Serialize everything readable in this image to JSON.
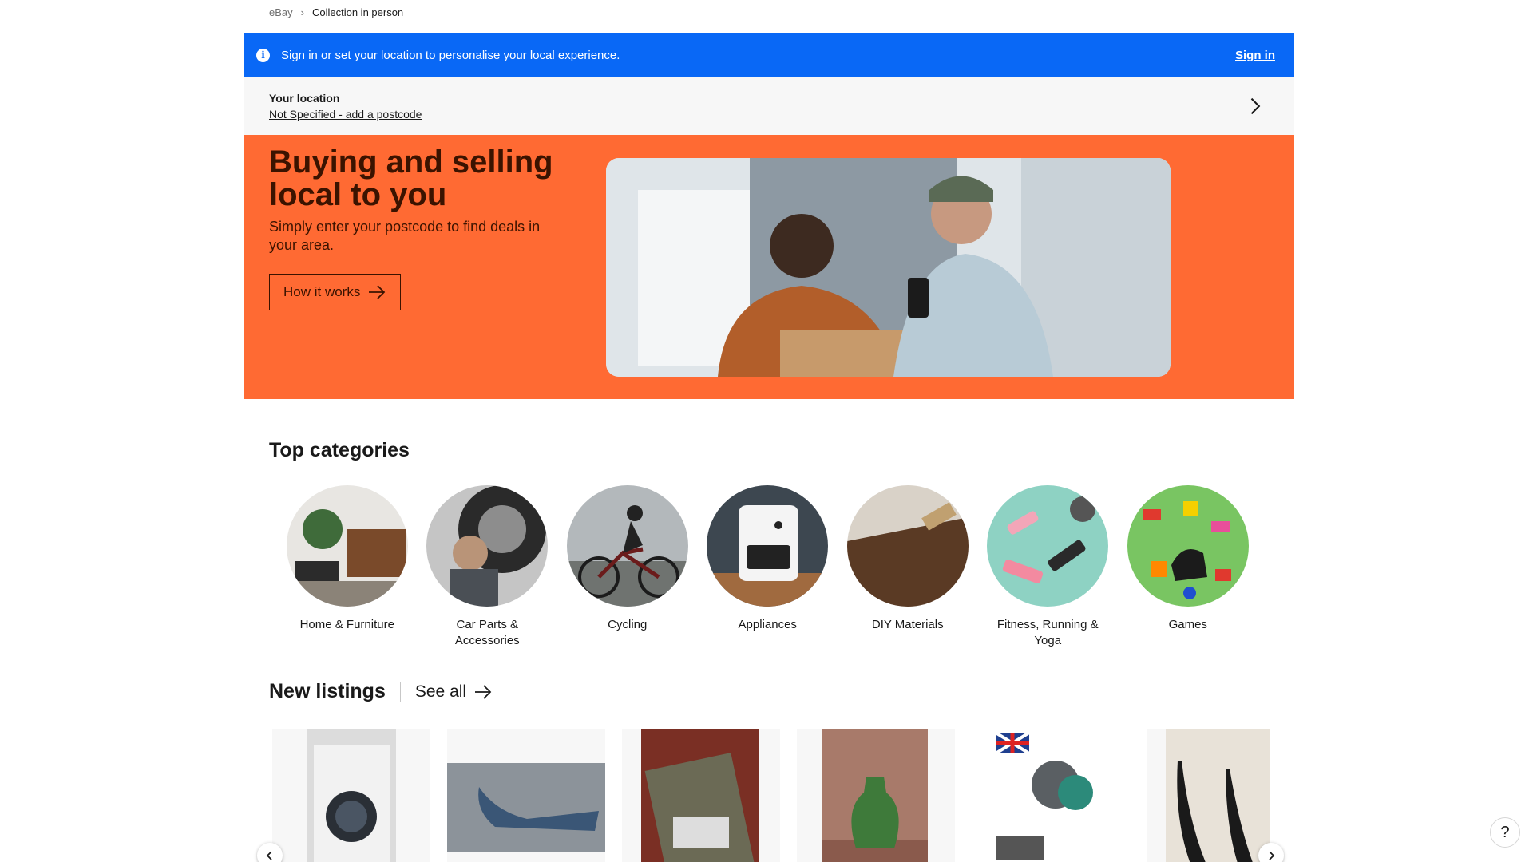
{
  "breadcrumb": {
    "root": "eBay",
    "current": "Collection in person"
  },
  "banner": {
    "message": "Sign in or set your location to personalise your local experience.",
    "sign_in": "Sign in",
    "color": "#0968f6"
  },
  "location": {
    "title": "Your location",
    "value": "Not Specified - add a postcode"
  },
  "hero": {
    "title": "Buying and selling local to you",
    "subtitle": "Simply enter your postcode to find deals in your area.",
    "button": "How it works",
    "color": "#ff6a33"
  },
  "top_categories": {
    "title": "Top categories",
    "items": [
      {
        "label": "Home & Furniture",
        "icon": "home-furniture-image"
      },
      {
        "label": "Car Parts & Accessories",
        "icon": "car-parts-image"
      },
      {
        "label": "Cycling",
        "icon": "cycling-image"
      },
      {
        "label": "Appliances",
        "icon": "appliances-image"
      },
      {
        "label": "DIY Materials",
        "icon": "diy-materials-image"
      },
      {
        "label": "Fitness, Running & Yoga",
        "icon": "fitness-image"
      },
      {
        "label": "Games",
        "icon": "games-image"
      }
    ]
  },
  "new_listings": {
    "title": "New listings",
    "see_all": "See all",
    "items": [
      {
        "name": "washing-machine-image"
      },
      {
        "name": "car-trim-part-image"
      },
      {
        "name": "wizard-chess-set-image"
      },
      {
        "name": "green-vase-image"
      },
      {
        "name": "turbo-charger-image"
      },
      {
        "name": "black-heels-image"
      }
    ]
  },
  "help": {
    "label": "?"
  }
}
